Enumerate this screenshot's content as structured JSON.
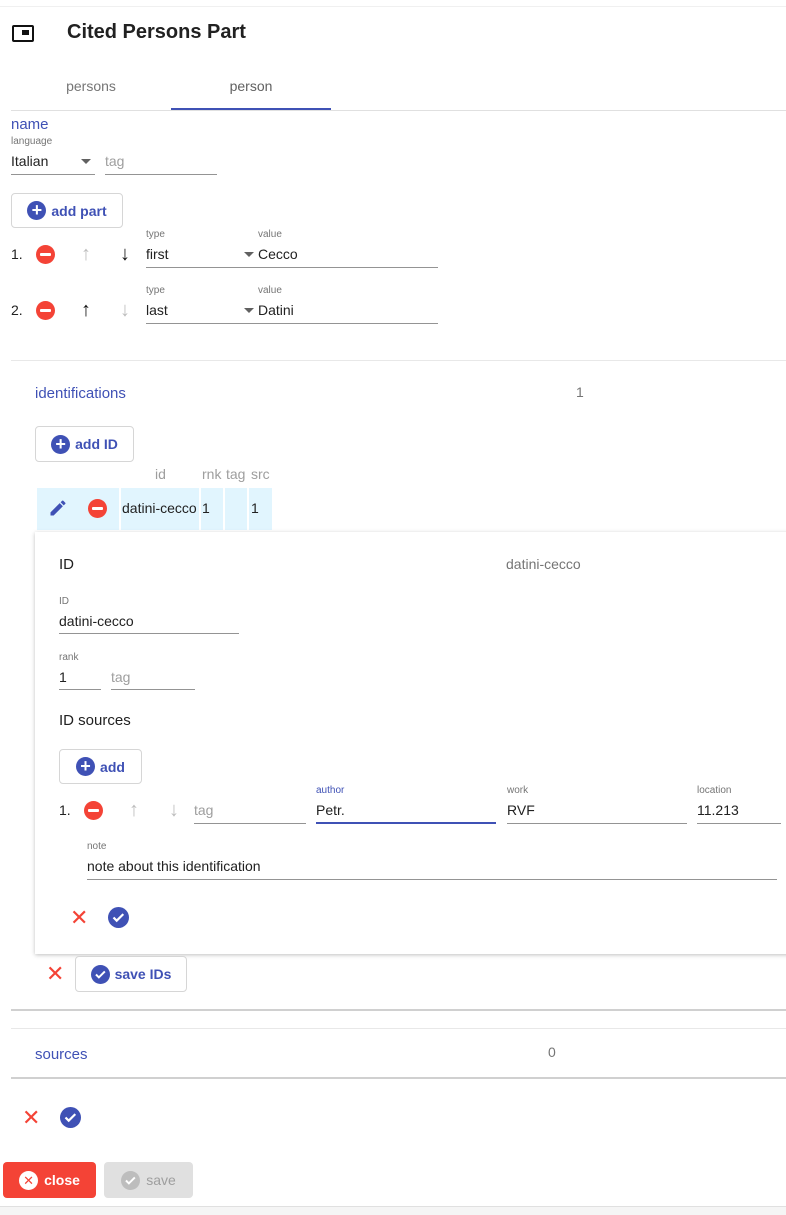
{
  "header": {
    "title": "Cited Persons Part",
    "icon": "card-icon"
  },
  "tabs": [
    {
      "label": "persons"
    },
    {
      "label": "person"
    }
  ],
  "name": {
    "heading": "name",
    "language_label": "language",
    "language_value": "Italian",
    "tag_placeholder": "tag",
    "add_part_label": "add part",
    "parts": [
      {
        "index": "1.",
        "type_label": "type",
        "type_value": "first",
        "value_label": "value",
        "value": "Cecco"
      },
      {
        "index": "2.",
        "type_label": "type",
        "type_value": "last",
        "value_label": "value",
        "value": "Datini"
      }
    ]
  },
  "identifications": {
    "heading": "identifications",
    "count": "1",
    "add_id_label": "add ID",
    "columns": [
      "id",
      "rnk",
      "tag",
      "src"
    ],
    "rows": [
      {
        "id": "datini-cecco",
        "rnk": "1",
        "tag": "",
        "src": "1"
      }
    ],
    "editor": {
      "title": "ID",
      "title_value": "datini-cecco",
      "id_label": "ID",
      "id_value": "datini-cecco",
      "rank_label": "rank",
      "rank_value": "1",
      "tag_placeholder": "tag",
      "sources_heading": "ID sources",
      "add_label": "add",
      "source": {
        "index": "1.",
        "tag_placeholder": "tag",
        "author_label": "author",
        "author_value": "Petr.",
        "work_label": "work",
        "work_value": "RVF",
        "location_label": "location",
        "location_value": "11.213",
        "note_label": "note",
        "note_value": "note about this identification"
      }
    },
    "save_ids_label": "save IDs"
  },
  "sources": {
    "heading": "sources",
    "count": "0"
  },
  "footer": {
    "close_label": "close",
    "save_label": "save"
  },
  "colors": {
    "primary": "#3f51b5",
    "warn": "#f44336",
    "cell_bg": "#e1f5fe"
  }
}
